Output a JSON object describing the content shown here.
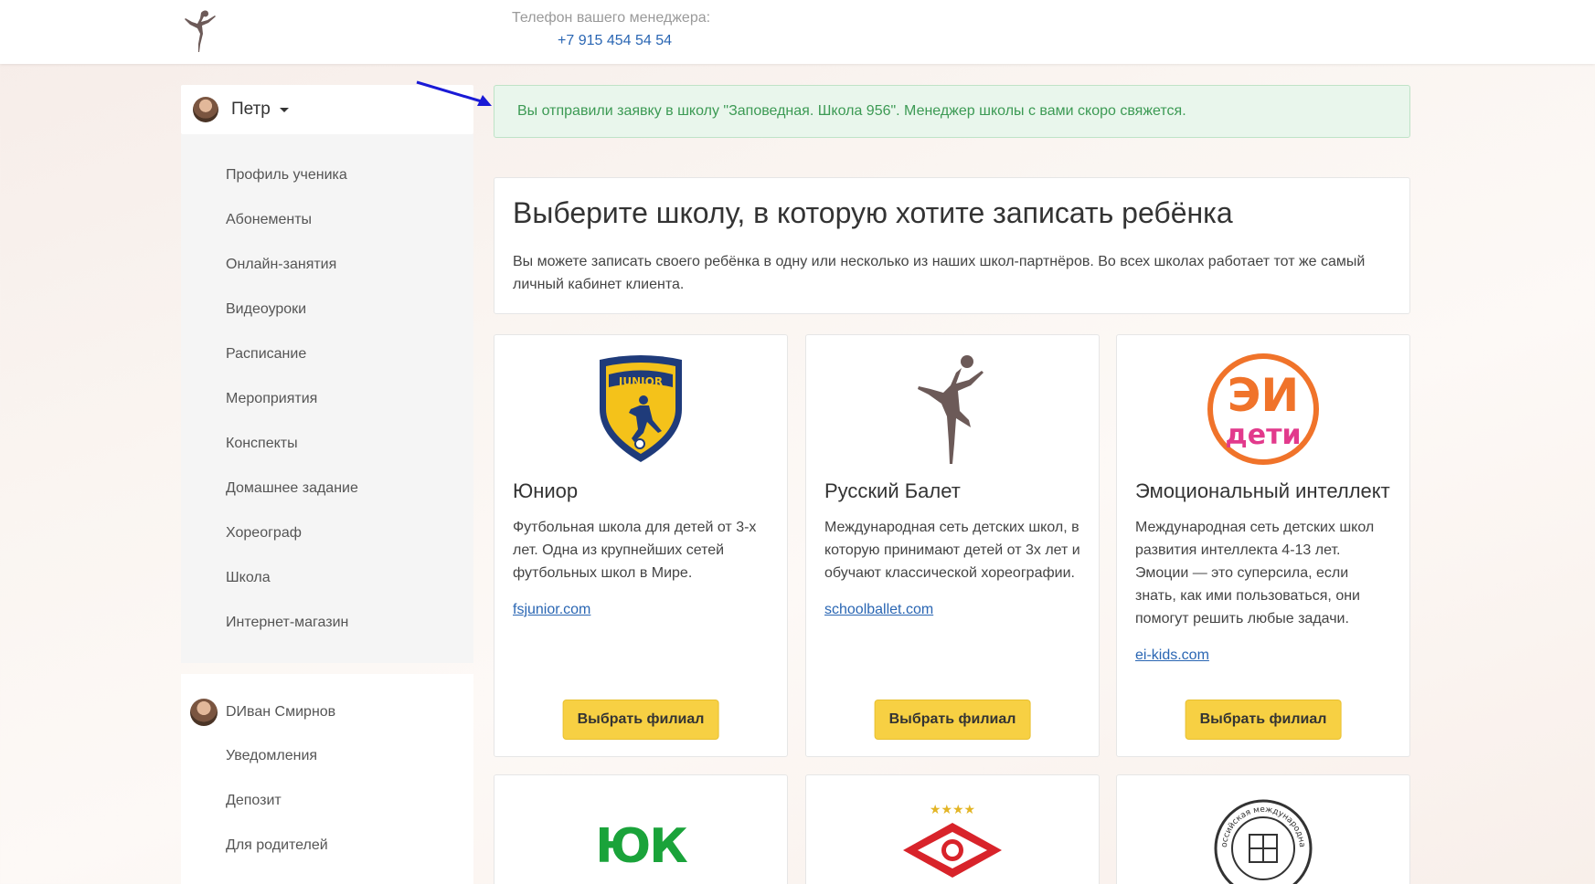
{
  "header": {
    "manager_label": "Телефон вашего менеджера:",
    "manager_phone": "+7 915 454 54 54"
  },
  "sidebar": {
    "user_name": "Петр",
    "menu": [
      {
        "label": "Профиль ученика"
      },
      {
        "label": "Абонементы"
      },
      {
        "label": "Онлайн-занятия"
      },
      {
        "label": "Видеоуроки"
      },
      {
        "label": "Расписание"
      },
      {
        "label": "Мероприятия"
      },
      {
        "label": "Конспекты"
      },
      {
        "label": "Домашнее задание"
      },
      {
        "label": "Хореограф"
      },
      {
        "label": "Школа"
      },
      {
        "label": "Интернет-магазин"
      }
    ],
    "parent_name": "DИван Смирнов",
    "parent_menu": [
      {
        "label": "Уведомления"
      },
      {
        "label": "Депозит"
      },
      {
        "label": "Для родителей"
      }
    ]
  },
  "alert": {
    "text": "Вы отправили заявку в школу \"Заповедная. Школа 956\". Менеджер школы с вами скоро свяжется."
  },
  "intro": {
    "title": "Выберите школу, в которую хотите записать ребёнка",
    "text": "Вы можете записать своего ребёнка в одну или несколько из наших школ-партнёров. Во всех школах работает тот же самый личный кабинет клиента."
  },
  "schools": [
    {
      "name": "Юниор",
      "desc": "Футбольная школа для детей от 3-х лет. Одна из крупнейших сетей футбольных школ в Мире.",
      "link": "fsjunior.com",
      "button": "Выбрать филиал",
      "logo_text": "JUNIOR",
      "icon": "junior-shield-logo"
    },
    {
      "name": "Русский Балет",
      "desc": "Международная сеть детских школ, в которую принимают детей от 3х лет и обучают классической хореографии.",
      "link": "schoolballet.com",
      "button": "Выбрать филиал",
      "icon": "ballerina-logo"
    },
    {
      "name": "Эмоциональный интеллект",
      "desc": "Международная сеть детских школ развития интеллекта 4-13 лет. Эмоции — это суперсила, если знать, как ими пользоваться, они помогут решить любые задачи.",
      "link": "ei-kids.com",
      "button": "Выбрать филиал",
      "logo_text_top": "ЭИ",
      "logo_text_bottom": "дети",
      "icon": "ei-kids-logo"
    },
    {
      "logo_text": "ЮК",
      "icon": "yuk-logo"
    },
    {
      "icon": "spartak-logo"
    },
    {
      "logo_text": "Российская международная",
      "icon": "round-seal-logo"
    }
  ],
  "colors": {
    "button": "#f7d043",
    "link": "#2a66b3",
    "alert_text": "#3c9a54",
    "alert_bg": "#e9f6ec"
  }
}
